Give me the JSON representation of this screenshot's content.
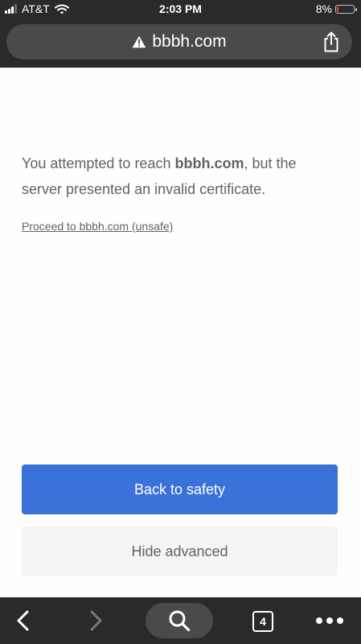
{
  "status_bar": {
    "carrier": "AT&T",
    "time": "2:03 PM",
    "battery_percent": "8%",
    "battery_level": 0.08,
    "battery_color": "#ff3b30",
    "icons": [
      "signal-icon",
      "wifi-icon",
      "battery-icon"
    ]
  },
  "address_bar": {
    "url": "bbbh.com",
    "security_icon": "warning-icon",
    "share_icon": "share-icon"
  },
  "error_page": {
    "message_prefix": "You attempted to reach ",
    "message_domain": "bbbh.com",
    "message_suffix": ", but the server presented an invalid certificate.",
    "proceed_link": "Proceed to bbbh.com (unsafe)",
    "primary_button": "Back to safety",
    "secondary_button": "Hide advanced"
  },
  "toolbar": {
    "tab_count": "4",
    "icons": [
      "back-icon",
      "forward-icon",
      "search-icon",
      "tabs-icon",
      "more-icon"
    ]
  },
  "colors": {
    "bars_background": "#2a2a2c",
    "url_pill": "#4a4a4c",
    "primary_button": "#3a72d9",
    "secondary_button": "#f5f5f5",
    "body_text": "#5f6368"
  }
}
